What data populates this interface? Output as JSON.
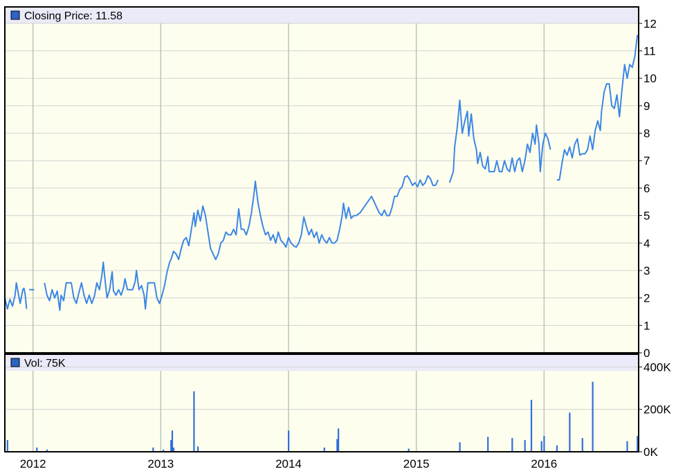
{
  "colors": {
    "plot_background": "#fefeee",
    "legend_band": "#eaeaf8",
    "line": "#3b86e6",
    "volume_bar": "#2f6fd8",
    "legend_swatch": "#2a64c8",
    "grid": "#d2d2d2",
    "year_line": "#b8c4c0",
    "frame": "#000000"
  },
  "chart_data": [
    {
      "type": "line",
      "legend": "Closing Price: 11.58",
      "ylim": [
        0,
        12.6
      ],
      "yticks": [
        0,
        1,
        2,
        3,
        4,
        5,
        6,
        7,
        8,
        9,
        10,
        11,
        12
      ],
      "ytick_labels": [
        "0",
        "1",
        "2",
        "3",
        "4",
        "5",
        "6",
        "7",
        "8",
        "9",
        "10",
        "11",
        "12"
      ],
      "xlim": [
        2011.78,
        2016.74
      ],
      "xticks": [
        2012,
        2013,
        2014,
        2015,
        2016
      ],
      "xtick_labels": [
        "2012",
        "2013",
        "2014",
        "2015",
        "2016"
      ],
      "grid": true,
      "segments": [
        [
          [
            2011.78,
            2.0
          ],
          [
            2011.8,
            1.6
          ],
          [
            2011.82,
            1.95
          ],
          [
            2011.84,
            1.7
          ],
          [
            2011.86,
            2.1
          ],
          [
            2011.87,
            2.55
          ],
          [
            2011.89,
            2.05
          ],
          [
            2011.9,
            1.8
          ],
          [
            2011.92,
            2.3
          ],
          [
            2011.93,
            2.35
          ],
          [
            2011.94,
            2.1
          ],
          [
            2011.95,
            1.6
          ]
        ],
        [
          [
            2011.97,
            2.3
          ],
          [
            2012.01,
            2.3
          ]
        ],
        [
          [
            2012.09,
            2.55
          ],
          [
            2012.11,
            2.1
          ],
          [
            2012.13,
            1.9
          ],
          [
            2012.15,
            2.3
          ],
          [
            2012.17,
            2.0
          ],
          [
            2012.19,
            2.25
          ],
          [
            2012.21,
            1.55
          ],
          [
            2012.22,
            2.1
          ],
          [
            2012.24,
            1.9
          ],
          [
            2012.26,
            2.55
          ],
          [
            2012.3,
            2.55
          ],
          [
            2012.32,
            2.0
          ],
          [
            2012.34,
            1.8
          ],
          [
            2012.36,
            2.2
          ],
          [
            2012.38,
            2.55
          ],
          [
            2012.4,
            2.1
          ],
          [
            2012.42,
            1.8
          ],
          [
            2012.44,
            2.1
          ],
          [
            2012.46,
            1.8
          ],
          [
            2012.48,
            2.05
          ],
          [
            2012.5,
            2.55
          ],
          [
            2012.52,
            2.3
          ],
          [
            2012.54,
            2.85
          ],
          [
            2012.55,
            3.3
          ],
          [
            2012.57,
            2.4
          ],
          [
            2012.58,
            2.0
          ],
          [
            2012.6,
            2.3
          ],
          [
            2012.62,
            2.95
          ],
          [
            2012.63,
            2.25
          ],
          [
            2012.65,
            2.1
          ],
          [
            2012.67,
            2.3
          ],
          [
            2012.69,
            2.1
          ],
          [
            2012.71,
            2.4
          ],
          [
            2012.72,
            2.7
          ],
          [
            2012.74,
            2.3
          ],
          [
            2012.76,
            2.3
          ],
          [
            2012.78,
            2.3
          ],
          [
            2012.8,
            2.6
          ],
          [
            2012.81,
            3.0
          ],
          [
            2012.83,
            2.3
          ],
          [
            2012.85,
            2.45
          ],
          [
            2012.87,
            2.1
          ],
          [
            2012.88,
            1.6
          ],
          [
            2012.9,
            2.55
          ],
          [
            2012.93,
            2.55
          ],
          [
            2012.95,
            2.55
          ],
          [
            2012.97,
            2.0
          ],
          [
            2012.99,
            1.8
          ],
          [
            2013.01,
            2.1
          ],
          [
            2013.03,
            2.45
          ],
          [
            2013.05,
            2.95
          ],
          [
            2013.07,
            3.3
          ],
          [
            2013.08,
            3.4
          ],
          [
            2013.1,
            3.7
          ],
          [
            2013.12,
            3.6
          ],
          [
            2013.14,
            3.4
          ],
          [
            2013.16,
            3.8
          ],
          [
            2013.18,
            4.1
          ],
          [
            2013.2,
            4.2
          ],
          [
            2013.22,
            3.9
          ],
          [
            2013.24,
            4.5
          ],
          [
            2013.26,
            5.1
          ],
          [
            2013.27,
            4.6
          ],
          [
            2013.29,
            5.2
          ],
          [
            2013.31,
            4.8
          ],
          [
            2013.33,
            5.35
          ],
          [
            2013.35,
            5.0
          ],
          [
            2013.37,
            4.4
          ],
          [
            2013.39,
            3.8
          ],
          [
            2013.41,
            3.6
          ],
          [
            2013.43,
            3.4
          ],
          [
            2013.45,
            3.6
          ],
          [
            2013.47,
            4.0
          ],
          [
            2013.49,
            4.1
          ],
          [
            2013.51,
            4.4
          ],
          [
            2013.53,
            4.3
          ],
          [
            2013.55,
            4.3
          ],
          [
            2013.57,
            4.5
          ],
          [
            2013.59,
            4.3
          ],
          [
            2013.61,
            5.25
          ],
          [
            2013.63,
            4.5
          ],
          [
            2013.65,
            4.5
          ],
          [
            2013.67,
            4.3
          ],
          [
            2013.69,
            4.6
          ],
          [
            2013.71,
            5.1
          ],
          [
            2013.73,
            5.8
          ],
          [
            2013.74,
            6.25
          ],
          [
            2013.76,
            5.5
          ],
          [
            2013.78,
            5.0
          ],
          [
            2013.8,
            4.6
          ],
          [
            2013.82,
            4.3
          ],
          [
            2013.84,
            4.4
          ],
          [
            2013.86,
            4.1
          ],
          [
            2013.88,
            4.3
          ],
          [
            2013.9,
            4.0
          ],
          [
            2013.92,
            4.4
          ],
          [
            2013.94,
            4.1
          ],
          [
            2013.96,
            4.0
          ],
          [
            2013.98,
            3.85
          ],
          [
            2014.0,
            4.2
          ],
          [
            2014.02,
            4.0
          ],
          [
            2014.04,
            3.9
          ],
          [
            2014.06,
            3.85
          ],
          [
            2014.08,
            4.0
          ],
          [
            2014.1,
            4.3
          ],
          [
            2014.12,
            4.95
          ],
          [
            2014.14,
            4.6
          ],
          [
            2014.16,
            4.3
          ],
          [
            2014.18,
            4.5
          ],
          [
            2014.2,
            4.2
          ],
          [
            2014.22,
            4.4
          ],
          [
            2014.24,
            4.0
          ],
          [
            2014.26,
            4.3
          ],
          [
            2014.28,
            4.1
          ],
          [
            2014.3,
            4.0
          ],
          [
            2014.32,
            4.2
          ],
          [
            2014.34,
            4.0
          ],
          [
            2014.36,
            4.0
          ],
          [
            2014.38,
            4.1
          ],
          [
            2014.4,
            4.5
          ],
          [
            2014.42,
            5.0
          ],
          [
            2014.43,
            5.45
          ],
          [
            2014.45,
            4.9
          ],
          [
            2014.47,
            5.3
          ],
          [
            2014.49,
            4.9
          ],
          [
            2014.51,
            5.0
          ],
          [
            2014.53,
            5.0
          ],
          [
            2014.56,
            5.1
          ],
          [
            2014.59,
            5.3
          ],
          [
            2014.62,
            5.5
          ],
          [
            2014.65,
            5.7
          ],
          [
            2014.67,
            5.5
          ],
          [
            2014.69,
            5.3
          ],
          [
            2014.71,
            5.1
          ],
          [
            2014.73,
            5.0
          ],
          [
            2014.75,
            5.2
          ],
          [
            2014.77,
            5.0
          ],
          [
            2014.79,
            5.0
          ],
          [
            2014.81,
            5.3
          ],
          [
            2014.83,
            5.7
          ],
          [
            2014.85,
            5.7
          ],
          [
            2014.87,
            5.95
          ],
          [
            2014.89,
            6.05
          ],
          [
            2014.91,
            6.4
          ],
          [
            2014.93,
            6.45
          ],
          [
            2014.95,
            6.3
          ],
          [
            2014.97,
            6.1
          ],
          [
            2014.99,
            6.2
          ],
          [
            2015.01,
            6.05
          ],
          [
            2015.03,
            6.3
          ],
          [
            2015.05,
            6.1
          ],
          [
            2015.07,
            6.2
          ],
          [
            2015.09,
            6.45
          ],
          [
            2015.11,
            6.35
          ],
          [
            2015.13,
            6.1
          ],
          [
            2015.15,
            6.1
          ],
          [
            2015.17,
            6.3
          ]
        ],
        [
          [
            2015.26,
            6.2
          ],
          [
            2015.29,
            6.6
          ],
          [
            2015.3,
            7.5
          ],
          [
            2015.32,
            8.2
          ],
          [
            2015.34,
            9.2
          ],
          [
            2015.36,
            8.0
          ],
          [
            2015.38,
            8.45
          ],
          [
            2015.4,
            8.8
          ],
          [
            2015.41,
            7.9
          ],
          [
            2015.43,
            8.7
          ],
          [
            2015.45,
            7.8
          ],
          [
            2015.47,
            7.4
          ],
          [
            2015.48,
            6.9
          ],
          [
            2015.5,
            7.3
          ],
          [
            2015.52,
            6.8
          ],
          [
            2015.54,
            6.7
          ],
          [
            2015.56,
            7.15
          ],
          [
            2015.57,
            6.6
          ],
          [
            2015.59,
            6.6
          ],
          [
            2015.61,
            6.6
          ],
          [
            2015.63,
            7.0
          ],
          [
            2015.65,
            6.6
          ],
          [
            2015.67,
            6.6
          ],
          [
            2015.69,
            7.0
          ],
          [
            2015.71,
            6.7
          ],
          [
            2015.73,
            6.6
          ],
          [
            2015.75,
            7.1
          ],
          [
            2015.77,
            6.6
          ],
          [
            2015.79,
            7.0
          ],
          [
            2015.81,
            7.1
          ],
          [
            2015.83,
            6.6
          ],
          [
            2015.85,
            7.0
          ],
          [
            2015.87,
            7.6
          ],
          [
            2015.89,
            7.3
          ],
          [
            2015.91,
            8.0
          ],
          [
            2015.93,
            7.6
          ],
          [
            2015.94,
            8.3
          ],
          [
            2015.96,
            7.6
          ],
          [
            2015.97,
            6.6
          ],
          [
            2015.99,
            7.6
          ],
          [
            2016.01,
            8.0
          ],
          [
            2016.03,
            7.8
          ],
          [
            2016.05,
            7.4
          ]
        ],
        [
          [
            2016.1,
            6.3
          ],
          [
            2016.12,
            6.3
          ],
          [
            2016.14,
            6.9
          ],
          [
            2016.16,
            7.4
          ],
          [
            2016.18,
            7.2
          ],
          [
            2016.2,
            7.5
          ],
          [
            2016.22,
            7.1
          ],
          [
            2016.24,
            7.6
          ],
          [
            2016.26,
            7.8
          ],
          [
            2016.28,
            7.2
          ],
          [
            2016.3,
            7.25
          ],
          [
            2016.32,
            7.25
          ],
          [
            2016.34,
            7.4
          ],
          [
            2016.36,
            7.9
          ],
          [
            2016.38,
            7.4
          ],
          [
            2016.4,
            8.1
          ],
          [
            2016.42,
            8.45
          ],
          [
            2016.44,
            8.1
          ],
          [
            2016.45,
            8.8
          ],
          [
            2016.47,
            9.5
          ],
          [
            2016.49,
            9.8
          ],
          [
            2016.51,
            9.8
          ],
          [
            2016.53,
            9.0
          ],
          [
            2016.55,
            8.9
          ],
          [
            2016.57,
            9.4
          ],
          [
            2016.59,
            8.6
          ],
          [
            2016.61,
            9.6
          ],
          [
            2016.63,
            10.5
          ],
          [
            2016.65,
            10.0
          ],
          [
            2016.67,
            10.5
          ],
          [
            2016.69,
            10.4
          ],
          [
            2016.71,
            10.8
          ],
          [
            2016.73,
            11.58
          ]
        ]
      ]
    },
    {
      "type": "bar",
      "legend": "Vol: 75K",
      "ylim": [
        0,
        460000
      ],
      "yticks": [
        0,
        200000,
        400000
      ],
      "ytick_labels": [
        "0K",
        "200K",
        "400K"
      ],
      "grid": true,
      "bars": [
        {
          "x": 2011.8,
          "v": 55000
        },
        {
          "x": 2012.03,
          "v": 20000
        },
        {
          "x": 2012.11,
          "v": 10000
        },
        {
          "x": 2012.94,
          "v": 20000
        },
        {
          "x": 2013.02,
          "v": 10000
        },
        {
          "x": 2013.08,
          "v": 55000
        },
        {
          "x": 2013.09,
          "v": 100000
        },
        {
          "x": 2013.1,
          "v": 20000
        },
        {
          "x": 2013.26,
          "v": 285000
        },
        {
          "x": 2013.29,
          "v": 25000
        },
        {
          "x": 2014.0,
          "v": 100000
        },
        {
          "x": 2014.28,
          "v": 20000
        },
        {
          "x": 2014.38,
          "v": 60000
        },
        {
          "x": 2014.39,
          "v": 110000
        },
        {
          "x": 2014.94,
          "v": 15000
        },
        {
          "x": 2015.34,
          "v": 45000
        },
        {
          "x": 2015.56,
          "v": 70000
        },
        {
          "x": 2015.75,
          "v": 65000
        },
        {
          "x": 2015.85,
          "v": 55000
        },
        {
          "x": 2015.9,
          "v": 245000
        },
        {
          "x": 2015.98,
          "v": 50000
        },
        {
          "x": 2016.0,
          "v": 75000
        },
        {
          "x": 2016.1,
          "v": 30000
        },
        {
          "x": 2016.2,
          "v": 185000
        },
        {
          "x": 2016.3,
          "v": 65000
        },
        {
          "x": 2016.38,
          "v": 330000
        },
        {
          "x": 2016.65,
          "v": 50000
        },
        {
          "x": 2016.73,
          "v": 75000
        }
      ]
    }
  ]
}
